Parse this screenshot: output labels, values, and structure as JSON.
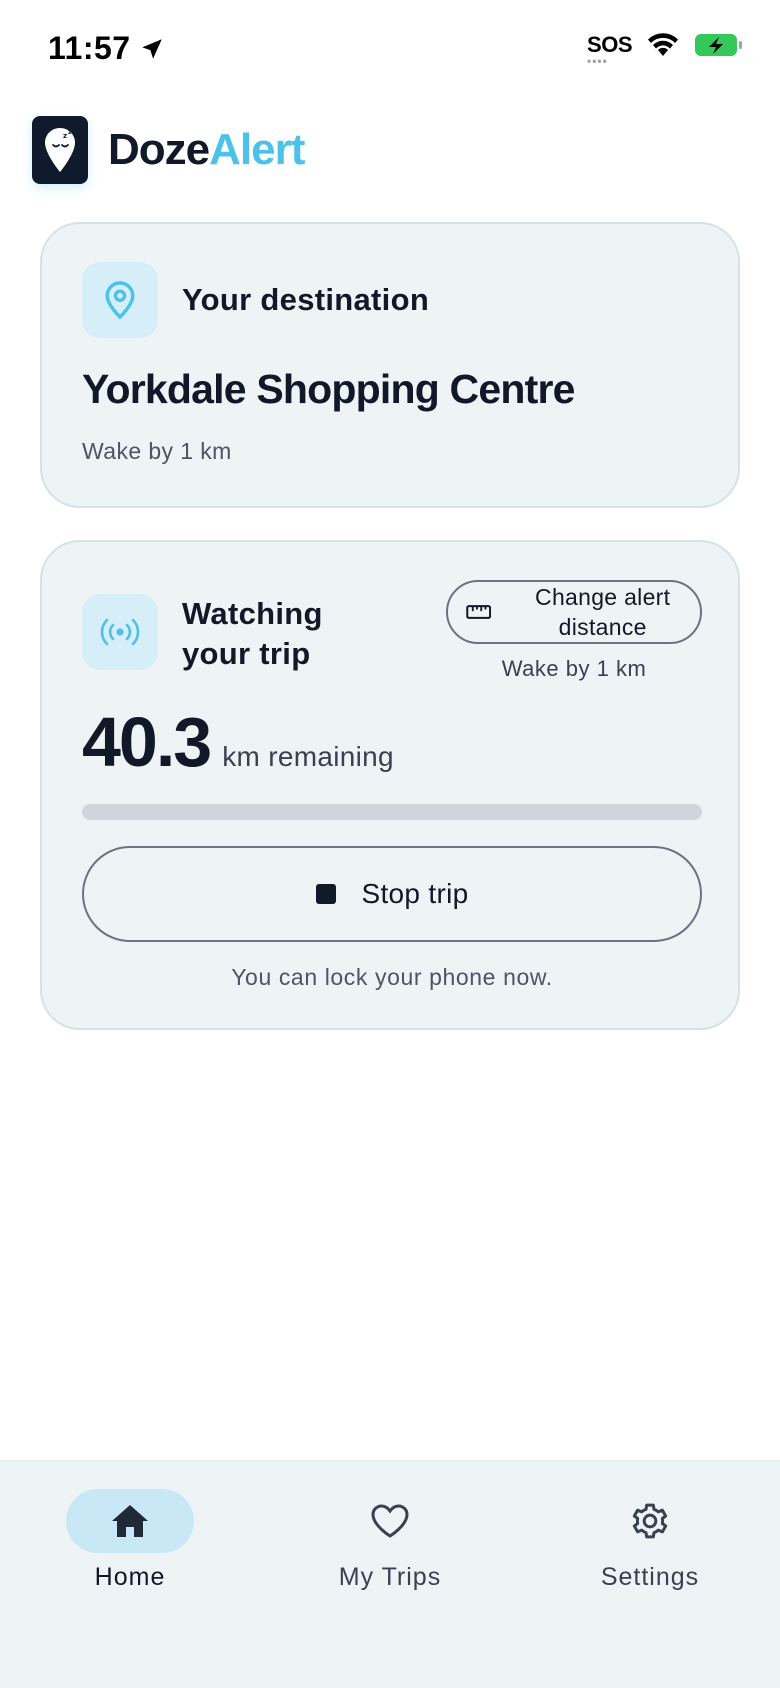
{
  "status_bar": {
    "time": "11:57",
    "sos": "SOS",
    "battery_color": "#34c759"
  },
  "app": {
    "name_part1": "Doze",
    "name_part2": "Alert",
    "accent_color": "#4cc2ea"
  },
  "destination_card": {
    "icon": "map-pin-icon",
    "label": "Your destination",
    "destination": "Yorkdale Shopping Centre",
    "wake_distance": "Wake by 1 km"
  },
  "trip_card": {
    "icon": "broadcast-icon",
    "label": "Watching your trip",
    "change_button": {
      "icon": "ruler-icon",
      "label": "Change alert distance"
    },
    "wake_distance": "Wake by 1 km",
    "distance_value": "40.3",
    "distance_unit": "km remaining",
    "progress_percent": 0,
    "stop_button": {
      "icon": "stop-icon",
      "label": "Stop trip"
    },
    "footnote": "You can lock your phone now."
  },
  "bottom_nav": {
    "items": [
      {
        "label": "Home",
        "icon": "home-icon",
        "active": true
      },
      {
        "label": "My Trips",
        "icon": "heart-icon",
        "active": false
      },
      {
        "label": "Settings",
        "icon": "gear-icon",
        "active": false
      }
    ]
  }
}
